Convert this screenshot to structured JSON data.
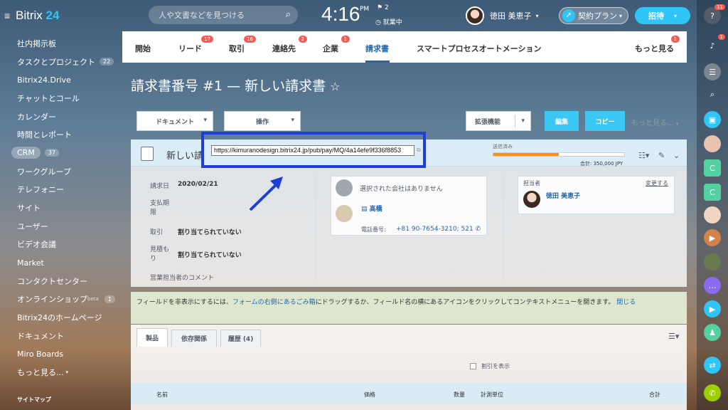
{
  "app": {
    "logo_text": "Bitrix",
    "logo_num": "24"
  },
  "search": {
    "placeholder": "人や文書などを見つける"
  },
  "clock": {
    "time": "4:16",
    "ampm": "PM",
    "flag_count": "2",
    "status": "就業中"
  },
  "user": {
    "name": "徳田 美恵子"
  },
  "plan_button": "契約プラン",
  "invite_button": "招待",
  "sidebar": {
    "items": [
      {
        "label": "社内掲示板"
      },
      {
        "label": "タスクとプロジェクト",
        "count": "22"
      },
      {
        "label": "Bitrix24.Drive"
      },
      {
        "label": "チャットとコール"
      },
      {
        "label": "カレンダー"
      },
      {
        "label": "時間とレポート"
      },
      {
        "label": "CRM",
        "count": "37"
      },
      {
        "label": "ワークグループ"
      },
      {
        "label": "テレフォニー"
      },
      {
        "label": "サイト"
      },
      {
        "label": "ユーザー"
      },
      {
        "label": "ビデオ会議"
      },
      {
        "label": "Market"
      },
      {
        "label": "コンタクトセンター"
      },
      {
        "label": "オンラインショップ",
        "sup": "beta",
        "count": "1"
      },
      {
        "label": "Bitrix24のホームページ"
      },
      {
        "label": "ドキュメント"
      },
      {
        "label": "Miro Boards"
      },
      {
        "label": "もっと見る..."
      }
    ],
    "sitemap": "サイトマップ"
  },
  "rightbar": {
    "help_badge": "11",
    "bell_badge": "1"
  },
  "tabs": [
    {
      "label": "開始"
    },
    {
      "label": "リード",
      "badge": "17"
    },
    {
      "label": "取引",
      "badge": "16"
    },
    {
      "label": "連絡先",
      "badge": "2"
    },
    {
      "label": "企業",
      "badge": "1"
    },
    {
      "label": "請求書"
    },
    {
      "label": "スマートプロセスオートメーション"
    },
    {
      "label": "もっと見る",
      "badge": "1"
    }
  ],
  "page_title": "請求書番号 #1 — 新しい請求書",
  "toolbar": {
    "document": "ドキュメント",
    "operation": "操作",
    "extensions": "拡張機能",
    "edit": "編集",
    "copy": "コピー",
    "more": "もっと見る..."
  },
  "card": {
    "title": "新しい請",
    "url": "https://kimuranodesign.bitrix24.jp/pub/pay/MQ/4a14efe9f336f8853",
    "status_label": "送信済み",
    "progress": 0.5,
    "total": "合計: 350,000 JPY",
    "fields": [
      {
        "label": "請求日",
        "value": "2020/02/21"
      },
      {
        "label": "支払期限",
        "value": ""
      },
      {
        "label": "取引",
        "value": "割り当てられていない"
      },
      {
        "label": "見積もり",
        "value": "割り当てられていない"
      },
      {
        "label": "営業担当者のコメント",
        "value": ""
      }
    ],
    "client": {
      "no_company": "選択された会社はありません",
      "contact_name": "高橋",
      "phone_label": "電話番号:",
      "phone": "+81 90-7654-3210; 521"
    },
    "responsible": {
      "label": "担当者",
      "change": "変更する",
      "name": "徳田 美恵子"
    }
  },
  "hint": {
    "pre": "フィールドを非表示にするには、",
    "link": "フォームの右側にあるごみ箱",
    "post": "にドラッグするか、フィールド名の横にあるアイコンをクリックしてコンテキストメニューを開きます。",
    "close": "閉じる"
  },
  "product_tabs": [
    {
      "label": "製品"
    },
    {
      "label": "依存関係"
    },
    {
      "label": "履歴 (4)"
    }
  ],
  "discount_label": "割引を表示",
  "table_columns": [
    "名前",
    "価格",
    "数量",
    "計測単位",
    "合計"
  ],
  "colors": {
    "accent": "#2fc6f6",
    "badge": "#ff5752",
    "highlight": "#1e3ed8",
    "progress": "#f59322"
  }
}
